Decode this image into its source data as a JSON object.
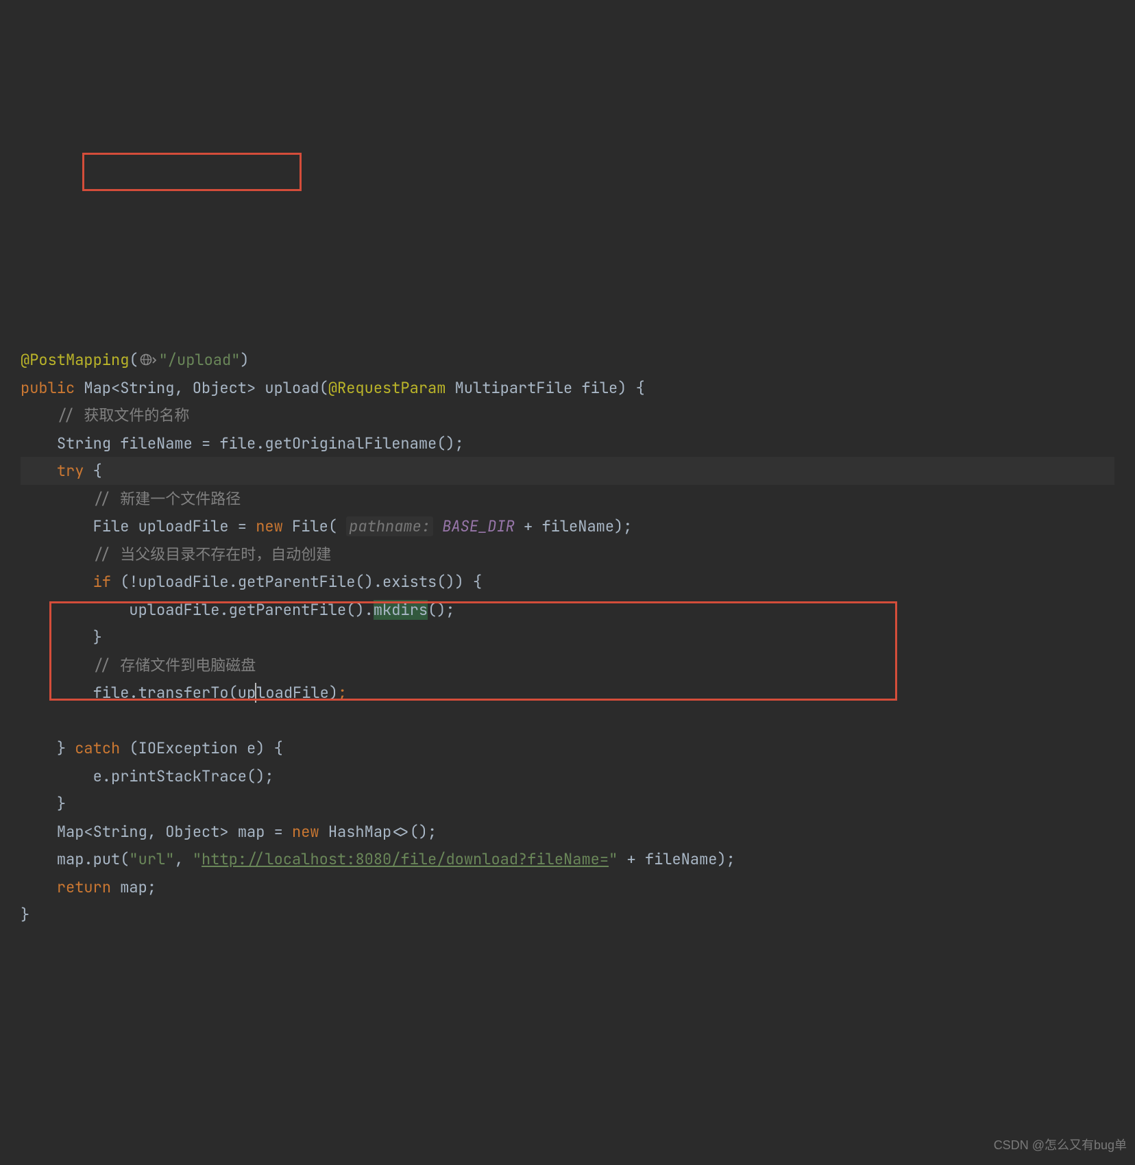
{
  "code": {
    "l1": {
      "ann": "@PostMapping",
      "p_open": "(",
      "route": "\"/upload\"",
      "p_close": ")"
    },
    "l2": {
      "kw_public": "public",
      "type": " Map<String, Object> ",
      "method": "upload",
      "sig_open": "(",
      "ann_param": "@RequestParam",
      "sig_rest": " MultipartFile file) {"
    },
    "l3": {
      "comment": "// 获取文件的名称"
    },
    "l4": {
      "text": "String fileName = file.getOriginalFilename();"
    },
    "l5": {
      "kw_try": "try",
      "rest": " {"
    },
    "l6": {
      "comment": "// 新建一个文件路径"
    },
    "l7": {
      "seg1": "File uploadFile = ",
      "kw_new": "new",
      "seg2": " File( ",
      "hint": "pathname:",
      "sp": " ",
      "const": "BASE_DIR",
      "seg3": " + fileName);"
    },
    "l8": {
      "comment": "// 当父级目录不存在时，自动创建"
    },
    "l9": {
      "kw_if": "if",
      "rest": " (!uploadFile.getParentFile().exists()) {"
    },
    "l10": {
      "seg1": "uploadFile.getParentFile().",
      "mk": "mkdirs",
      "seg2": "();"
    },
    "l11": {
      "brace": "}"
    },
    "l12": {
      "comment": "// 存储文件到电脑磁盘"
    },
    "l13": {
      "seg1": "file.transferTo(up",
      "seg2": "loadFile)",
      "semi": ";"
    },
    "l14": {
      "blank": ""
    },
    "l15": {
      "brace": "}",
      "kw_catch": " catch ",
      "rest": "(IOException e) {"
    },
    "l16": {
      "text": "e.printStackTrace();"
    },
    "l17": {
      "brace": "}"
    },
    "l18": {
      "seg1": "Map<String, Object> map = ",
      "kw_new": "new",
      "seg2": " HashMap<>();"
    },
    "l19": {
      "seg1": "map.put(",
      "str1": "\"url\"",
      "seg2": ", ",
      "str2a": "\"",
      "url": "http://localhost:8080/file/download?fileName=",
      "str2b": "\"",
      "seg3": " + fileName);"
    },
    "l20": {
      "kw_return": "return",
      "rest": " map;"
    },
    "l21": {
      "brace": "}"
    }
  },
  "watermark": "CSDN @怎么又有bug单"
}
